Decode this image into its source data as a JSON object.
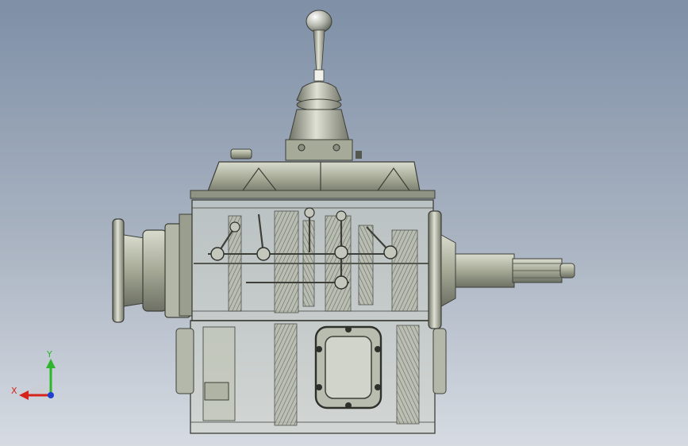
{
  "viewport": {
    "model": "manual-gearbox-assembly",
    "view": "front-orthographic",
    "background_top": "#7e8fa6",
    "background_bottom": "#d6dbe2",
    "metal_color": "#a7ab9b",
    "metal_dark": "#4c4f48",
    "glass_color": "#c9cec6"
  },
  "triad": {
    "x_label": "X",
    "y_label": "Y",
    "x_color": "#d4241c",
    "y_color": "#2fb52c",
    "z_color": "#1f3fd0"
  }
}
